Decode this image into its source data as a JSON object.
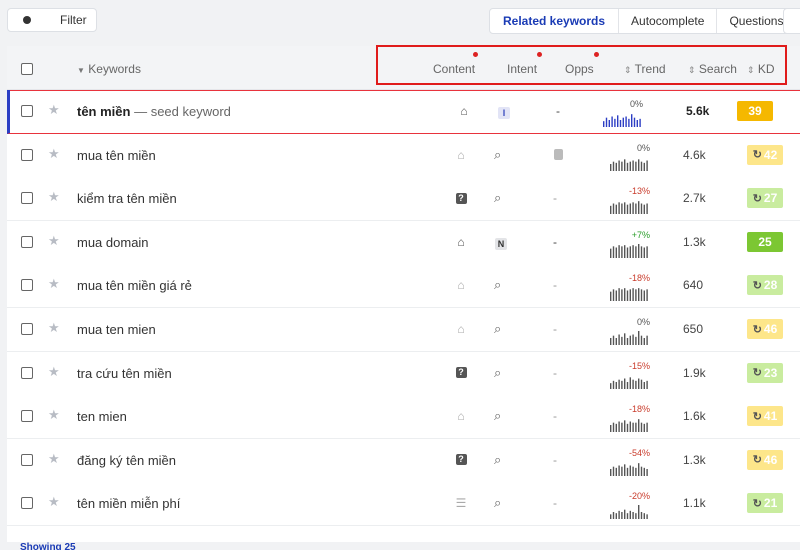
{
  "topbar": {
    "filter_label": "Filter",
    "tabs": [
      {
        "label": "Related keywords",
        "active": true
      },
      {
        "label": "Autocomplete",
        "active": false
      },
      {
        "label": "Questions",
        "active": false
      }
    ]
  },
  "header": {
    "keywords": "Keywords",
    "content": "Content",
    "intent": "Intent",
    "opps": "Opps",
    "trend": "Trend",
    "search": "Search",
    "kd": "KD"
  },
  "rows": [
    {
      "keyword": "tên miền",
      "seed_tag": " — seed keyword",
      "content_icon": "home-icon",
      "intent": "I",
      "opps": "-",
      "trend": "0%",
      "trend_dir": "zero",
      "bars": [
        5,
        8,
        6,
        9,
        7,
        10,
        6,
        8,
        9,
        7,
        11,
        8,
        6,
        7
      ],
      "search": "5.6k",
      "kd": "39",
      "kd_color": "#f5b800",
      "kd_style": "solid"
    },
    {
      "keyword": "mua tên miền",
      "content_icon": "home-icon",
      "intent": "search",
      "opps": "lock",
      "trend": "0%",
      "trend_dir": "zero",
      "bars": [
        6,
        8,
        7,
        9,
        8,
        10,
        7,
        8,
        9,
        8,
        10,
        8,
        7,
        9
      ],
      "search": "4.6k",
      "kd": "42",
      "kd_color": "#fde68a",
      "kd_style": "refresh"
    },
    {
      "keyword": "kiểm tra tên miền",
      "content_icon": "question-icon",
      "intent": "search",
      "opps": "-",
      "trend": "-13%",
      "trend_dir": "neg",
      "bars": [
        7,
        9,
        8,
        10,
        9,
        10,
        8,
        9,
        10,
        9,
        11,
        9,
        8,
        9
      ],
      "search": "2.7k",
      "kd": "27",
      "kd_color": "#c9ec9f",
      "kd_style": "refresh"
    },
    {
      "keyword": "mua domain",
      "content_icon": "home-icon",
      "intent": "N",
      "opps": "-",
      "trend": "+7%",
      "trend_dir": "pos",
      "bars": [
        8,
        10,
        9,
        11,
        10,
        11,
        9,
        10,
        11,
        10,
        12,
        10,
        9,
        10
      ],
      "search": "1.3k",
      "kd": "25",
      "kd_color": "#7cc733",
      "kd_style": "solid"
    },
    {
      "keyword": "mua tên miền giá rẻ",
      "content_icon": "home-icon",
      "intent": "search",
      "opps": "-",
      "trend": "-18%",
      "trend_dir": "neg",
      "bars": [
        8,
        10,
        9,
        11,
        10,
        11,
        9,
        10,
        11,
        10,
        11,
        10,
        9,
        10
      ],
      "search": "640",
      "kd": "28",
      "kd_color": "#c9ec9f",
      "kd_style": "refresh"
    },
    {
      "keyword": "mua ten mien",
      "content_icon": "home-icon",
      "intent": "search",
      "opps": "-",
      "trend": "0%",
      "trend_dir": "zero",
      "bars": [
        6,
        8,
        6,
        9,
        7,
        10,
        6,
        8,
        9,
        7,
        12,
        8,
        6,
        8
      ],
      "search": "650",
      "kd": "46",
      "kd_color": "#fde68a",
      "kd_style": "refresh"
    },
    {
      "keyword": "tra cứu tên miền",
      "content_icon": "question-icon",
      "intent": "search",
      "opps": "-",
      "trend": "-15%",
      "trend_dir": "neg",
      "bars": [
        5,
        7,
        6,
        8,
        7,
        9,
        6,
        10,
        8,
        7,
        9,
        8,
        6,
        7
      ],
      "search": "1.9k",
      "kd": "23",
      "kd_color": "#c9ec9f",
      "kd_style": "refresh"
    },
    {
      "keyword": "ten mien",
      "content_icon": "home-icon",
      "intent": "search",
      "opps": "-",
      "trend": "-18%",
      "trend_dir": "neg",
      "bars": [
        6,
        8,
        7,
        9,
        8,
        10,
        7,
        9,
        8,
        8,
        11,
        8,
        7,
        8
      ],
      "search": "1.6k",
      "kd": "41",
      "kd_color": "#fde68a",
      "kd_style": "refresh"
    },
    {
      "keyword": "đăng ký tên miền",
      "content_icon": "question-icon",
      "intent": "search",
      "opps": "-",
      "trend": "-54%",
      "trend_dir": "neg",
      "bars": [
        6,
        8,
        7,
        9,
        8,
        10,
        7,
        9,
        8,
        7,
        11,
        8,
        7,
        6
      ],
      "search": "1.3k",
      "kd": "46",
      "kd_color": "#fde68a",
      "kd_style": "refresh"
    },
    {
      "keyword": "tên miền miễn phí",
      "content_icon": "list-icon",
      "intent": "search",
      "opps": "-",
      "trend": "-20%",
      "trend_dir": "neg",
      "bars": [
        4,
        6,
        5,
        7,
        6,
        8,
        5,
        7,
        6,
        5,
        12,
        6,
        5,
        4
      ],
      "search": "1.1k",
      "kd": "21",
      "kd_color": "#c9ec9f",
      "kd_style": "refresh"
    }
  ],
  "footer": {
    "showing": "Showing 25"
  }
}
